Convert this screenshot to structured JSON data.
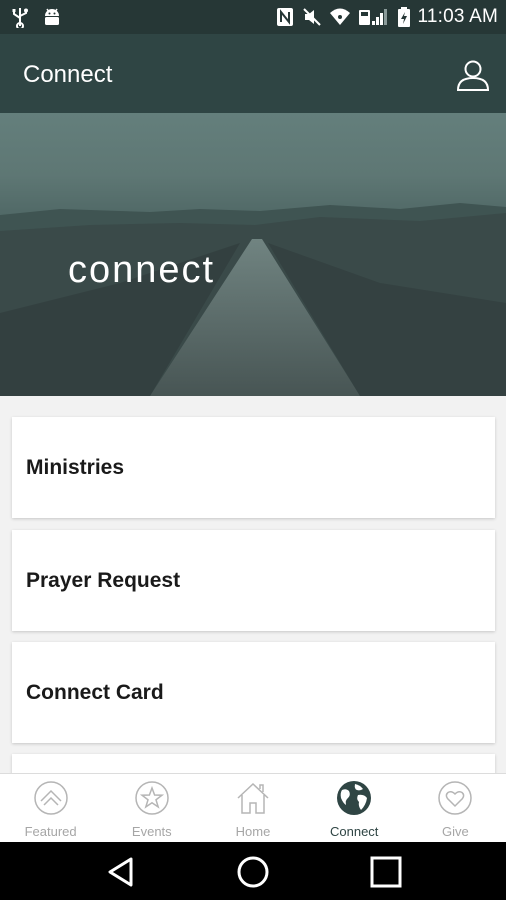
{
  "status_bar": {
    "time": "11:03 AM",
    "left_icons": [
      "usb-icon",
      "android-icon"
    ],
    "right_icons": [
      "nfc-icon",
      "mute-icon",
      "wifi-icon",
      "signal-icon",
      "battery-icon"
    ]
  },
  "app_bar": {
    "title": "Connect",
    "profile_icon": "person-icon"
  },
  "hero": {
    "title": "connect"
  },
  "list": {
    "items": [
      {
        "label": "Ministries"
      },
      {
        "label": "Prayer Request"
      },
      {
        "label": "Connect Card"
      },
      {
        "label": ""
      }
    ]
  },
  "bottom_nav": {
    "items": [
      {
        "label": "Featured",
        "icon": "chevron-up-circle-icon",
        "active": false
      },
      {
        "label": "Events",
        "icon": "star-circle-icon",
        "active": false
      },
      {
        "label": "Home",
        "icon": "home-icon",
        "active": false
      },
      {
        "label": "Connect",
        "icon": "globe-icon",
        "active": true
      },
      {
        "label": "Give",
        "icon": "heart-circle-icon",
        "active": false
      }
    ]
  },
  "colors": {
    "status_bar": "#263736",
    "app_bar": "#2f4544",
    "active_nav": "#2f4544",
    "inactive_nav": "#a6a6a6"
  }
}
